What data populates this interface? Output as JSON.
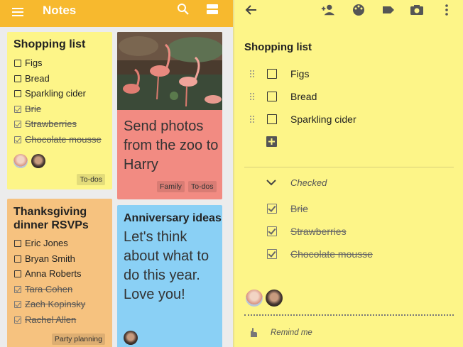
{
  "topbar": {
    "title": "Notes",
    "icons": [
      "menu-icon",
      "search-icon",
      "grid-view-icon"
    ]
  },
  "cards": {
    "shopping": {
      "title": "Shopping list",
      "items": [
        {
          "text": "Figs",
          "checked": false
        },
        {
          "text": "Bread",
          "checked": false
        },
        {
          "text": "Sparkling cider",
          "checked": false
        },
        {
          "text": "Brie",
          "checked": true
        },
        {
          "text": "Strawberries",
          "checked": true
        },
        {
          "text": "Chocolate mousse",
          "checked": true
        }
      ],
      "label": "To-dos",
      "color": "#fdf588"
    },
    "zoo": {
      "text": "Send photos from the zoo to Harry",
      "labels": [
        "Family",
        "To-dos"
      ],
      "color": "#f28b82"
    },
    "thanksgiving": {
      "title": "Thanksgiving dinner RSVPs",
      "items": [
        {
          "text": "Eric Jones",
          "checked": false
        },
        {
          "text": "Bryan Smith",
          "checked": false
        },
        {
          "text": "Anna Roberts",
          "checked": false
        },
        {
          "text": "Tara Cohen",
          "checked": true
        },
        {
          "text": "Zach Kopinsky",
          "checked": true
        },
        {
          "text": "Rachel Allen",
          "checked": true
        }
      ],
      "label": "Party planning",
      "color": "#f6c27f"
    },
    "anniversary": {
      "title": "Anniversary ideas",
      "text": "Let's think about what to do this year. Love you!",
      "color": "#8ad0f5"
    }
  },
  "editor": {
    "toolbar_icons": [
      "back-arrow-icon",
      "add-collaborator-icon",
      "palette-icon",
      "label-icon",
      "camera-icon",
      "more-vert-icon"
    ],
    "title": "Shopping list",
    "unchecked": [
      "Figs",
      "Bread",
      "Sparkling cider"
    ],
    "checked_header": "Checked",
    "checked": [
      "Brie",
      "Strawberries",
      "Chocolate mousse"
    ],
    "reminder": "Remind me",
    "color": "#fdf588"
  }
}
